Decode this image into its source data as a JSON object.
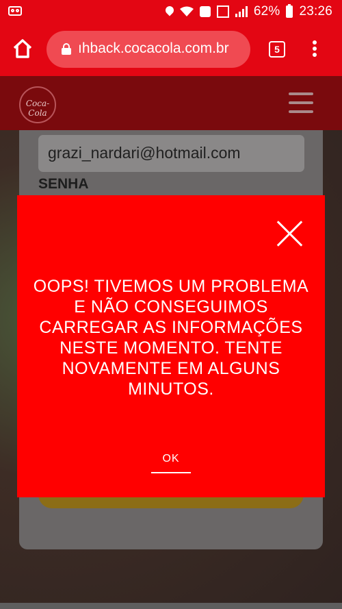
{
  "status_bar": {
    "battery_percent": "62%",
    "time": "23:26",
    "icons": [
      "voicemail-icon",
      "location-icon",
      "wifi-icon",
      "heart-icon",
      "data-saver-icon",
      "signal-icon",
      "battery-icon"
    ]
  },
  "browser": {
    "url": "ıhback.cocacola.com.br",
    "tab_count": "5",
    "icons": [
      "home-icon",
      "lock-icon",
      "tabs-icon",
      "more-vert-icon"
    ]
  },
  "site": {
    "logo_text": "Coca-Cola",
    "menu_icon": "hamburger-icon"
  },
  "form": {
    "email_value": "grazi_nardari@hotmail.com",
    "password_label": "SENHA"
  },
  "modal": {
    "message": "OOPS! TIVEMOS UM PROBLEMA E NÃO CONSEGUIMOS CARREGAR AS INFORMAÇÕES NESTE MOMENTO. TENTE NOVAMENTE EM ALGUNS MINUTOS.",
    "ok_label": "OK",
    "close_icon": "close-icon"
  },
  "colors": {
    "brand_red": "#e30613",
    "modal_red": "#ff0000",
    "header_dark_red": "#7a0a0d"
  }
}
